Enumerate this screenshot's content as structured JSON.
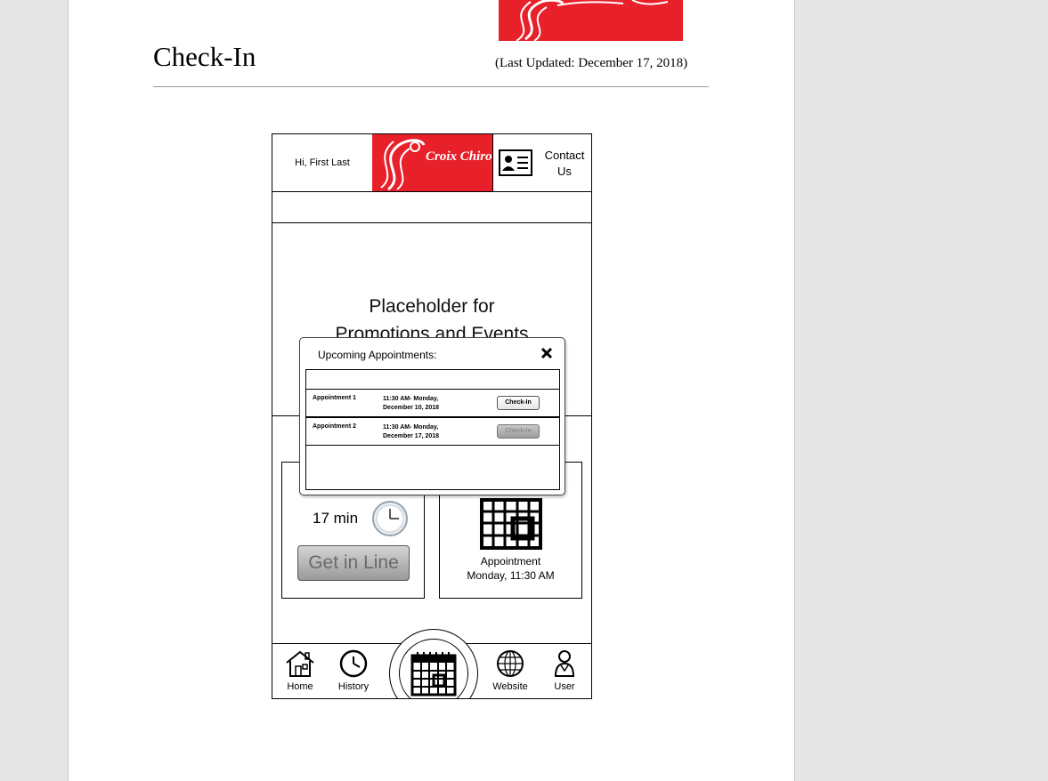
{
  "document": {
    "title": "Check-In",
    "updated": "(Last Updated: December 17, 2018)"
  },
  "app": {
    "greeting": "Hi, First Last",
    "contact_line1": "Contact",
    "contact_line2": "Us",
    "promo_line1": "Placeholder for",
    "promo_line2": "Promotions and Events",
    "wait_time": "17 min",
    "get_in_line": "Get in Line",
    "appointment_line1": "Appointment",
    "appointment_line2": "Monday, 11:30 AM",
    "logo_text": "Croix Chiro",
    "brand_color": "#e8202a"
  },
  "modal": {
    "title": "Upcoming Appointments:",
    "rows": [
      {
        "name": "Appointment 1",
        "time_line1": "11:30 AM- Monday,",
        "time_line2": "December 10, 2018",
        "button": "Check-In",
        "enabled": true
      },
      {
        "name": "Appointment 2",
        "time_line1": "11:30 AM- Monday,",
        "time_line2": "December 17, 2018",
        "button": "Check-In",
        "enabled": false
      }
    ]
  },
  "nav": {
    "home": "Home",
    "history": "History",
    "website": "Website",
    "user": "User"
  },
  "icons": [
    "home-icon",
    "history-icon",
    "calendar-icon",
    "website-icon",
    "user-icon",
    "contact-card-icon",
    "clock-icon",
    "close-icon"
  ]
}
